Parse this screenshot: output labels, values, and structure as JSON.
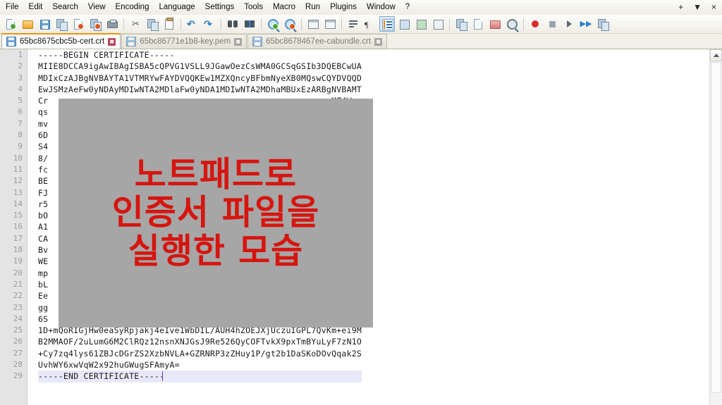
{
  "window": {
    "title": "Notepad++",
    "controls": {
      "add": "+",
      "dropdown": "▼",
      "close": "×"
    }
  },
  "menubar": {
    "items": [
      {
        "label": "File",
        "icon": "menu-file"
      },
      {
        "label": "Edit",
        "icon": "menu-edit"
      },
      {
        "label": "Search",
        "icon": "menu-search"
      },
      {
        "label": "View",
        "icon": "menu-view"
      },
      {
        "label": "Encoding",
        "icon": "menu-encoding"
      },
      {
        "label": "Language",
        "icon": "menu-language"
      },
      {
        "label": "Settings",
        "icon": "menu-settings"
      },
      {
        "label": "Tools",
        "icon": "menu-tools"
      },
      {
        "label": "Macro",
        "icon": "menu-macro"
      },
      {
        "label": "Run",
        "icon": "menu-run"
      },
      {
        "label": "Plugins",
        "icon": "menu-plugins"
      },
      {
        "label": "Window",
        "icon": "menu-window"
      },
      {
        "label": "?",
        "icon": "menu-help"
      }
    ]
  },
  "toolbar": {
    "buttons": [
      {
        "name": "new-file-icon"
      },
      {
        "name": "open-file-icon"
      },
      {
        "name": "save-icon"
      },
      {
        "name": "save-all-icon"
      },
      {
        "name": "close-file-icon"
      },
      {
        "name": "close-all-files-icon"
      },
      {
        "name": "print-icon"
      },
      {
        "name": "separator-1"
      },
      {
        "name": "cut-icon"
      },
      {
        "name": "copy-icon"
      },
      {
        "name": "paste-icon"
      },
      {
        "name": "separator-2"
      },
      {
        "name": "undo-icon"
      },
      {
        "name": "redo-icon"
      },
      {
        "name": "separator-3"
      },
      {
        "name": "find-icon"
      },
      {
        "name": "replace-icon"
      },
      {
        "name": "separator-4"
      },
      {
        "name": "zoom-in-icon"
      },
      {
        "name": "zoom-out-icon"
      },
      {
        "name": "separator-5"
      },
      {
        "name": "sync-vertical-scrolling-icon"
      },
      {
        "name": "sync-horizontal-scrolling-icon"
      },
      {
        "name": "separator-6"
      },
      {
        "name": "word-wrap-icon"
      },
      {
        "name": "show-all-characters-icon"
      },
      {
        "name": "indent-guide-icon",
        "active": true
      },
      {
        "name": "user-defined-dialog-icon"
      },
      {
        "name": "document-map-icon"
      },
      {
        "name": "function-list-icon"
      },
      {
        "name": "separator-7"
      },
      {
        "name": "folder-as-workspace-icon"
      },
      {
        "name": "monitoring-icon"
      },
      {
        "name": "folder-icon"
      },
      {
        "name": "preview-icon"
      },
      {
        "name": "separator-8"
      },
      {
        "name": "record-macro-icon"
      },
      {
        "name": "stop-recording-icon"
      },
      {
        "name": "play-macro-icon"
      },
      {
        "name": "run-macro-multiple-icon"
      },
      {
        "name": "save-macro-icon"
      }
    ]
  },
  "tabs": [
    {
      "label": "65bc8675cbc5b-cert.crt",
      "active": true,
      "close": "✖"
    },
    {
      "label": "65bc86771e1b8-key.pem",
      "active": false,
      "close": "✖"
    },
    {
      "label": "65bc8678467ee-cabundle.crt",
      "active": false,
      "close": "✖"
    }
  ],
  "editor": {
    "current_line": 29,
    "line_numbers": [
      1,
      2,
      3,
      4,
      5,
      6,
      7,
      8,
      9,
      10,
      11,
      12,
      13,
      14,
      15,
      16,
      17,
      18,
      19,
      20,
      21,
      22,
      23,
      24,
      25,
      26,
      27,
      28,
      29
    ],
    "lines": [
      "-----BEGIN CERTIFICATE-----",
      "MIIE8DCCA9igAwIBAgISBA5cQPVG1VSLL9JGawOezCsWMA0GCSqGSIb3DQEBCwUA",
      "MDIxCzAJBgNVBAYTA1VTMRYwFAYDVQQKEw1MZXQncyBFbmNyeXB0MQswCQYDVQQD",
      "EwJSMzAeFw0yNDAyMDIwNTA2MDlaFw0yNDA1MDIwNTA2MDhaMBUxEzARBgNVBAMT",
      "Cr                                                        MZ4Wc",
      "qs                                                        on+Oy",
      "mv                                                        VhZjf",
      "6D                                                        r17KV",
      "S4                                                        aJrOS",
      "8/                                                        P8BOQ",
      "fc                                                        DVRO1",
      "BE                                                        OBBYE",
      "FJ                                                        JQOYf",
      "r5                                                        zLm8u",
      "bO                                                        vMCUG",
      "A1                                                        MMAow",
      "CA                                                        OizBb",
      "Bv                                                        w1cCH",
      "WE                                                        QS3Jo",
      "mp                                                        AAY1o",
      "bL                                                        JfQIg",
      "Ee                                                        LBQAD",
      "gg                                                        DA2Do",
      "6S                                                        IqeDb",
      "1D+mQoRIGjHw0eaSyRpjakj4eIve1WbDIL/AUH4hZOEJXjUczuIGPL7QvKm+ei9M",
      "B2MMAOF/2uLumG6M2ClRQz12nsnXNJGsJ9Re526QyCOFTvkX9pxTmBYuLyF7zN1O",
      "+Cy7zq4lys61ZBJcDGrZS2XzbNVLA+GZRNRP3zZHuy1P/gt2b1DaSKoDOvQqak2S",
      "UvhWY6xwVqW2x92huGWugSFAmyA=",
      "-----END CERTIFICATE-----"
    ]
  },
  "overlay": {
    "annotation_lines": [
      "노트패드로",
      "인증서 파일을",
      "실행한 모습"
    ],
    "text_color": "#d6150f",
    "background_color": "#a6a6a6"
  },
  "scrollbar": {
    "up_arrow": "▲"
  },
  "colors": {
    "accent_tab": "#f0940a",
    "current_line_bg": "#e8e8f8",
    "caret": "#7a2fbe",
    "gutter_bg": "#e4e4e4"
  }
}
